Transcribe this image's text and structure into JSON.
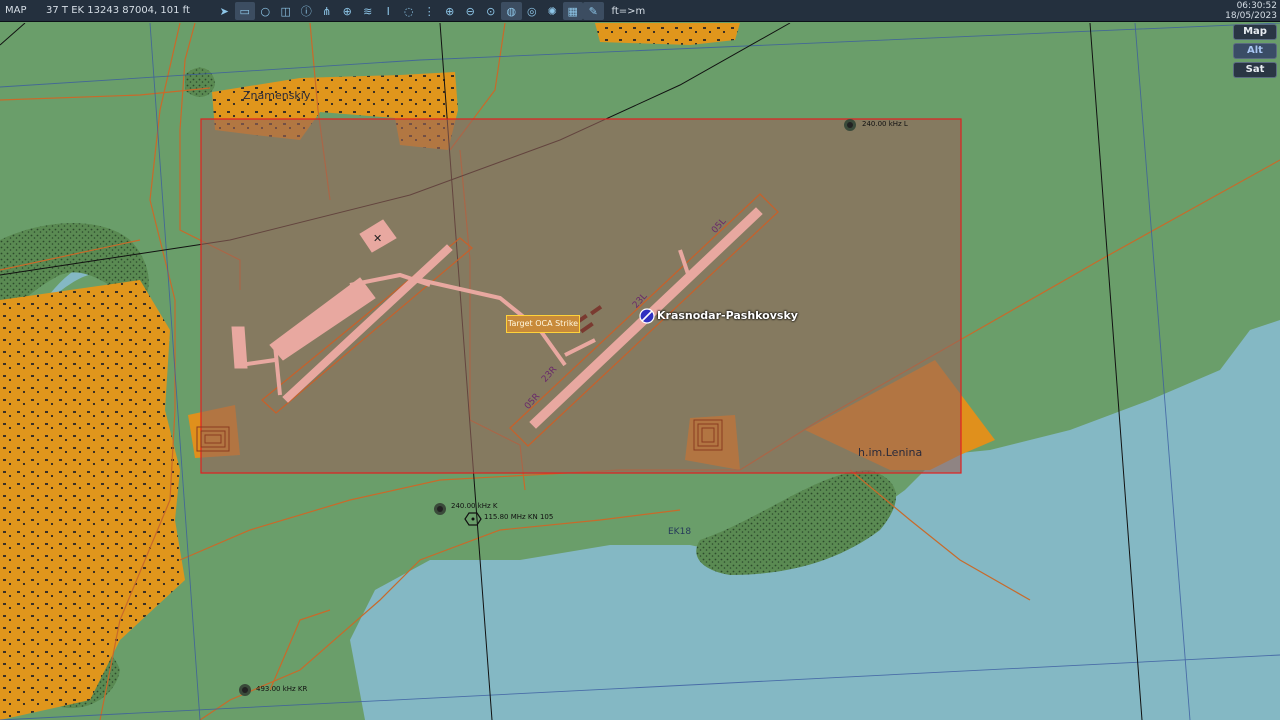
{
  "toolbar": {
    "mode": "MAP",
    "coordinates": "37 T EK 13243 87004, 101 ft",
    "tools": [
      "pointer-icon",
      "ruler-icon",
      "circle-icon",
      "layers-icon",
      "info-icon",
      "network-icon",
      "crosshair-icon",
      "signal-icon",
      "tower-icon",
      "chat-icon",
      "waypoint-icon",
      "zoom-in-icon",
      "zoom-out-icon",
      "zoom-reset-icon",
      "globe-icon",
      "radar-icon",
      "sun-icon",
      "grid-icon",
      "pencil-icon"
    ],
    "units": "ft=>m",
    "time": "06:30:52",
    "date": "18/05/2023"
  },
  "layers": [
    "Map",
    "Alt",
    "Sat"
  ],
  "active_layer": "Alt",
  "map": {
    "towns": [
      "Znamenskiy",
      "h.im.Lenina"
    ],
    "airfield": "Krasnodar-Pashkovsky",
    "target": "Target OCA Strike",
    "navaids": [
      "240.00 kHz L",
      "240.00 kHz K",
      "115.80 MHz KN 105",
      "493.00 kHz KR"
    ],
    "grid_label": "EK18",
    "runway_labels": [
      "05R",
      "23L",
      "05L",
      "23R"
    ],
    "colors": {
      "land": "#6a9e6a",
      "water": "#84b8c4",
      "urban": "#e0961c",
      "forest_dots": "#2c4a2c",
      "roads": "#c86a2a",
      "target_area_stroke": "#e02020",
      "airfield_pavement": "#e8a8a0"
    }
  }
}
